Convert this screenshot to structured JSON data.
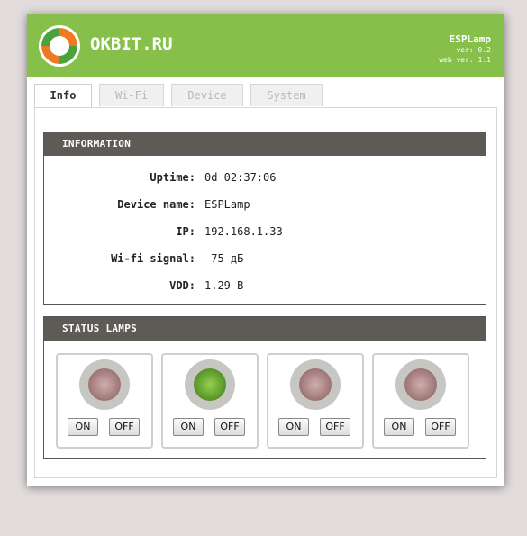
{
  "header": {
    "brand": "OKBIT.RU",
    "app_name": "ESPLamp",
    "version": "ver: 0.2",
    "web_version": "web ver: 1.1",
    "logo_icon": "okbit-logo-icon",
    "colors": {
      "header_bg": "#86c04b",
      "panel_title_bg": "#5e5a56"
    }
  },
  "tabs": [
    {
      "label": "Info",
      "active": true
    },
    {
      "label": "Wi-Fi",
      "active": false
    },
    {
      "label": "Device",
      "active": false
    },
    {
      "label": "System",
      "active": false
    }
  ],
  "information": {
    "title": "INFORMATION",
    "rows": [
      {
        "label": "Uptime:",
        "value": "0d 02:37:06"
      },
      {
        "label": "Device name:",
        "value": "ESPLamp"
      },
      {
        "label": "IP:",
        "value": "192.168.1.33"
      },
      {
        "label": "Wi-fi signal:",
        "value": "-75 дБ"
      },
      {
        "label": "VDD:",
        "value": "1.29 В"
      }
    ]
  },
  "status_lamps": {
    "title": "STATUS LAMPS",
    "on_label": "ON",
    "off_label": "OFF",
    "lamps": [
      {
        "state": "off",
        "icon": "lamp-icon"
      },
      {
        "state": "on",
        "icon": "lamp-icon"
      },
      {
        "state": "off",
        "icon": "lamp-icon"
      },
      {
        "state": "off",
        "icon": "lamp-icon"
      }
    ]
  }
}
